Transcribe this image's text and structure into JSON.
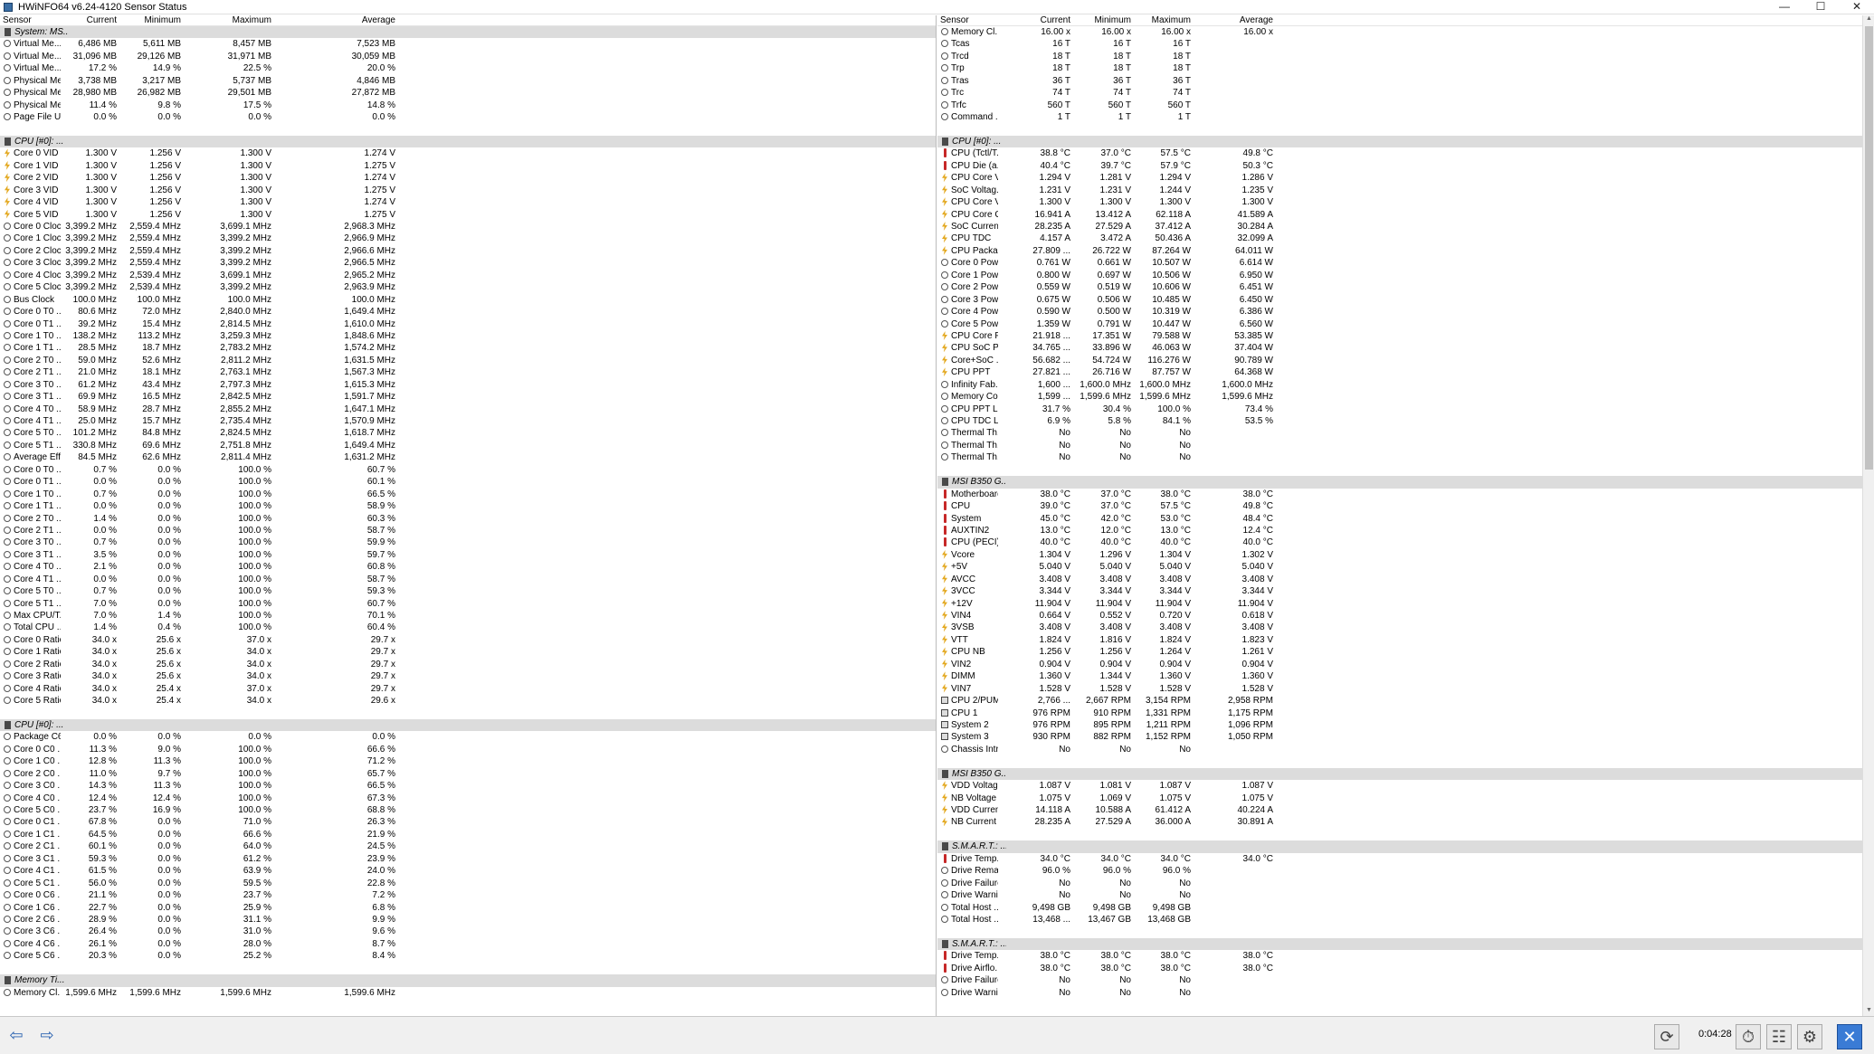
{
  "window": {
    "title": "HWiNFO64 v6.24-4120 Sensor Status",
    "minimize": "—",
    "maximize": "☐",
    "close": "✕"
  },
  "columns": [
    "Sensor",
    "Current",
    "Minimum",
    "Maximum",
    "Average"
  ],
  "left": [
    [
      "s",
      "System: MS..."
    ],
    [
      "c",
      "Virtual Me...",
      "6,486 MB",
      "5,611 MB",
      "8,457 MB",
      "7,523 MB"
    ],
    [
      "c",
      "Virtual Me...",
      "31,096 MB",
      "29,126 MB",
      "31,971 MB",
      "30,059 MB"
    ],
    [
      "c",
      "Virtual Me...",
      "17.2 %",
      "14.9 %",
      "22.5 %",
      "20.0 %"
    ],
    [
      "c",
      "Physical Me...",
      "3,738 MB",
      "3,217 MB",
      "5,737 MB",
      "4,846 MB"
    ],
    [
      "c",
      "Physical Me...",
      "28,980 MB",
      "26,982 MB",
      "29,501 MB",
      "27,872 MB"
    ],
    [
      "c",
      "Physical Me...",
      "11.4 %",
      "9.8 %",
      "17.5 %",
      "14.8 %"
    ],
    [
      "c",
      "Page File U...",
      "0.0 %",
      "0.0 %",
      "0.0 %",
      "0.0 %"
    ],
    [
      "x"
    ],
    [
      "s",
      "CPU [#0]: ..."
    ],
    [
      "v",
      "Core 0 VID",
      "1.300 V",
      "1.256 V",
      "1.300 V",
      "1.274 V"
    ],
    [
      "v",
      "Core 1 VID",
      "1.300 V",
      "1.256 V",
      "1.300 V",
      "1.275 V"
    ],
    [
      "v",
      "Core 2 VID",
      "1.300 V",
      "1.256 V",
      "1.300 V",
      "1.274 V"
    ],
    [
      "v",
      "Core 3 VID",
      "1.300 V",
      "1.256 V",
      "1.300 V",
      "1.275 V"
    ],
    [
      "v",
      "Core 4 VID",
      "1.300 V",
      "1.256 V",
      "1.300 V",
      "1.274 V"
    ],
    [
      "v",
      "Core 5 VID",
      "1.300 V",
      "1.256 V",
      "1.300 V",
      "1.275 V"
    ],
    [
      "c",
      "Core 0 Clock",
      "3,399.2 MHz",
      "2,559.4 MHz",
      "3,699.1 MHz",
      "2,968.3 MHz"
    ],
    [
      "c",
      "Core 1 Clock",
      "3,399.2 MHz",
      "2,559.4 MHz",
      "3,399.2 MHz",
      "2,966.9 MHz"
    ],
    [
      "c",
      "Core 2 Clock",
      "3,399.2 MHz",
      "2,559.4 MHz",
      "3,399.2 MHz",
      "2,966.6 MHz"
    ],
    [
      "c",
      "Core 3 Clock",
      "3,399.2 MHz",
      "2,559.4 MHz",
      "3,399.2 MHz",
      "2,966.5 MHz"
    ],
    [
      "c",
      "Core 4 Clock",
      "3,399.2 MHz",
      "2,539.4 MHz",
      "3,699.1 MHz",
      "2,965.2 MHz"
    ],
    [
      "c",
      "Core 5 Clock",
      "3,399.2 MHz",
      "2,539.4 MHz",
      "3,399.2 MHz",
      "2,963.9 MHz"
    ],
    [
      "c",
      "Bus Clock",
      "100.0 MHz",
      "100.0 MHz",
      "100.0 MHz",
      "100.0 MHz"
    ],
    [
      "c",
      "Core 0 T0 ...",
      "80.6 MHz",
      "72.0 MHz",
      "2,840.0 MHz",
      "1,649.4 MHz"
    ],
    [
      "c",
      "Core 0 T1 ...",
      "39.2 MHz",
      "15.4 MHz",
      "2,814.5 MHz",
      "1,610.0 MHz"
    ],
    [
      "c",
      "Core 1 T0 ...",
      "138.2 MHz",
      "113.2 MHz",
      "3,259.3 MHz",
      "1,848.6 MHz"
    ],
    [
      "c",
      "Core 1 T1 ...",
      "28.5 MHz",
      "18.7 MHz",
      "2,783.2 MHz",
      "1,574.2 MHz"
    ],
    [
      "c",
      "Core 2 T0 ...",
      "59.0 MHz",
      "52.6 MHz",
      "2,811.2 MHz",
      "1,631.5 MHz"
    ],
    [
      "c",
      "Core 2 T1 ...",
      "21.0 MHz",
      "18.1 MHz",
      "2,763.1 MHz",
      "1,567.3 MHz"
    ],
    [
      "c",
      "Core 3 T0 ...",
      "61.2 MHz",
      "43.4 MHz",
      "2,797.3 MHz",
      "1,615.3 MHz"
    ],
    [
      "c",
      "Core 3 T1 ...",
      "69.9 MHz",
      "16.5 MHz",
      "2,842.5 MHz",
      "1,591.7 MHz"
    ],
    [
      "c",
      "Core 4 T0 ...",
      "58.9 MHz",
      "28.7 MHz",
      "2,855.2 MHz",
      "1,647.1 MHz"
    ],
    [
      "c",
      "Core 4 T1 ...",
      "25.0 MHz",
      "15.7 MHz",
      "2,735.4 MHz",
      "1,570.9 MHz"
    ],
    [
      "c",
      "Core 5 T0 ...",
      "101.2 MHz",
      "84.8 MHz",
      "2,824.5 MHz",
      "1,618.7 MHz"
    ],
    [
      "c",
      "Core 5 T1 ...",
      "330.8 MHz",
      "69.6 MHz",
      "2,751.8 MHz",
      "1,649.4 MHz"
    ],
    [
      "c",
      "Average Eff...",
      "84.5 MHz",
      "62.6 MHz",
      "2,811.4 MHz",
      "1,631.2 MHz"
    ],
    [
      "c",
      "Core 0 T0 ...",
      "0.7 %",
      "0.0 %",
      "100.0 %",
      "60.7 %"
    ],
    [
      "c",
      "Core 0 T1 ...",
      "0.0 %",
      "0.0 %",
      "100.0 %",
      "60.1 %"
    ],
    [
      "c",
      "Core 1 T0 ...",
      "0.7 %",
      "0.0 %",
      "100.0 %",
      "66.5 %"
    ],
    [
      "c",
      "Core 1 T1 ...",
      "0.0 %",
      "0.0 %",
      "100.0 %",
      "58.9 %"
    ],
    [
      "c",
      "Core 2 T0 ...",
      "1.4 %",
      "0.0 %",
      "100.0 %",
      "60.3 %"
    ],
    [
      "c",
      "Core 2 T1 ...",
      "0.0 %",
      "0.0 %",
      "100.0 %",
      "58.7 %"
    ],
    [
      "c",
      "Core 3 T0 ...",
      "0.7 %",
      "0.0 %",
      "100.0 %",
      "59.9 %"
    ],
    [
      "c",
      "Core 3 T1 ...",
      "3.5 %",
      "0.0 %",
      "100.0 %",
      "59.7 %"
    ],
    [
      "c",
      "Core 4 T0 ...",
      "2.1 %",
      "0.0 %",
      "100.0 %",
      "60.8 %"
    ],
    [
      "c",
      "Core 4 T1 ...",
      "0.0 %",
      "0.0 %",
      "100.0 %",
      "58.7 %"
    ],
    [
      "c",
      "Core 5 T0 ...",
      "0.7 %",
      "0.0 %",
      "100.0 %",
      "59.3 %"
    ],
    [
      "c",
      "Core 5 T1 ...",
      "7.0 %",
      "0.0 %",
      "100.0 %",
      "60.7 %"
    ],
    [
      "c",
      "Max CPU/T...",
      "7.0 %",
      "1.4 %",
      "100.0 %",
      "70.1 %"
    ],
    [
      "c",
      "Total CPU ...",
      "1.4 %",
      "0.4 %",
      "100.0 %",
      "60.4 %"
    ],
    [
      "c",
      "Core 0 Ratio",
      "34.0 x",
      "25.6 x",
      "37.0 x",
      "29.7 x"
    ],
    [
      "c",
      "Core 1 Ratio",
      "34.0 x",
      "25.6 x",
      "34.0 x",
      "29.7 x"
    ],
    [
      "c",
      "Core 2 Ratio",
      "34.0 x",
      "25.6 x",
      "34.0 x",
      "29.7 x"
    ],
    [
      "c",
      "Core 3 Ratio",
      "34.0 x",
      "25.6 x",
      "34.0 x",
      "29.7 x"
    ],
    [
      "c",
      "Core 4 Ratio",
      "34.0 x",
      "25.4 x",
      "37.0 x",
      "29.7 x"
    ],
    [
      "c",
      "Core 5 Ratio",
      "34.0 x",
      "25.4 x",
      "34.0 x",
      "29.6 x"
    ],
    [
      "x"
    ],
    [
      "s",
      "CPU [#0]: ..."
    ],
    [
      "c",
      "Package C6...",
      "0.0 %",
      "0.0 %",
      "0.0 %",
      "0.0 %"
    ],
    [
      "c",
      "Core 0 C0 ...",
      "11.3 %",
      "9.0 %",
      "100.0 %",
      "66.6 %"
    ],
    [
      "c",
      "Core 1 C0 ...",
      "12.8 %",
      "11.3 %",
      "100.0 %",
      "71.2 %"
    ],
    [
      "c",
      "Core 2 C0 ...",
      "11.0 %",
      "9.7 %",
      "100.0 %",
      "65.7 %"
    ],
    [
      "c",
      "Core 3 C0 ...",
      "14.3 %",
      "11.3 %",
      "100.0 %",
      "66.5 %"
    ],
    [
      "c",
      "Core 4 C0 ...",
      "12.4 %",
      "12.4 %",
      "100.0 %",
      "67.3 %"
    ],
    [
      "c",
      "Core 5 C0 ...",
      "23.7 %",
      "16.9 %",
      "100.0 %",
      "68.8 %"
    ],
    [
      "c",
      "Core 0 C1 ...",
      "67.8 %",
      "0.0 %",
      "71.0 %",
      "26.3 %"
    ],
    [
      "c",
      "Core 1 C1 ...",
      "64.5 %",
      "0.0 %",
      "66.6 %",
      "21.9 %"
    ],
    [
      "c",
      "Core 2 C1 ...",
      "60.1 %",
      "0.0 %",
      "64.0 %",
      "24.5 %"
    ],
    [
      "c",
      "Core 3 C1 ...",
      "59.3 %",
      "0.0 %",
      "61.2 %",
      "23.9 %"
    ],
    [
      "c",
      "Core 4 C1 ...",
      "61.5 %",
      "0.0 %",
      "63.9 %",
      "24.0 %"
    ],
    [
      "c",
      "Core 5 C1 ...",
      "56.0 %",
      "0.0 %",
      "59.5 %",
      "22.8 %"
    ],
    [
      "c",
      "Core 0 C6 ...",
      "21.1 %",
      "0.0 %",
      "23.7 %",
      "7.2 %"
    ],
    [
      "c",
      "Core 1 C6 ...",
      "22.7 %",
      "0.0 %",
      "25.9 %",
      "6.8 %"
    ],
    [
      "c",
      "Core 2 C6 ...",
      "28.9 %",
      "0.0 %",
      "31.1 %",
      "9.9 %"
    ],
    [
      "c",
      "Core 3 C6 ...",
      "26.4 %",
      "0.0 %",
      "31.0 %",
      "9.6 %"
    ],
    [
      "c",
      "Core 4 C6 ...",
      "26.1 %",
      "0.0 %",
      "28.0 %",
      "8.7 %"
    ],
    [
      "c",
      "Core 5 C6 ...",
      "20.3 %",
      "0.0 %",
      "25.2 %",
      "8.4 %"
    ],
    [
      "x"
    ],
    [
      "s",
      "Memory Ti..."
    ],
    [
      "c",
      "Memory Cl...",
      "1,599.6 MHz",
      "1,599.6 MHz",
      "1,599.6 MHz",
      "1,599.6 MHz"
    ]
  ],
  "right": [
    [
      "c",
      "Memory Cl...",
      "16.00 x",
      "16.00 x",
      "16.00 x",
      "16.00 x"
    ],
    [
      "c",
      "Tcas",
      "16 T",
      "16 T",
      "16 T",
      ""
    ],
    [
      "c",
      "Trcd",
      "18 T",
      "18 T",
      "18 T",
      ""
    ],
    [
      "c",
      "Trp",
      "18 T",
      "18 T",
      "18 T",
      ""
    ],
    [
      "c",
      "Tras",
      "36 T",
      "36 T",
      "36 T",
      ""
    ],
    [
      "c",
      "Trc",
      "74 T",
      "74 T",
      "74 T",
      ""
    ],
    [
      "c",
      "Trfc",
      "560 T",
      "560 T",
      "560 T",
      ""
    ],
    [
      "c",
      "Command ...",
      "1 T",
      "1 T",
      "1 T",
      ""
    ],
    [
      "x"
    ],
    [
      "s",
      "CPU [#0]: ..."
    ],
    [
      "t",
      "CPU (Tctl/T...",
      "38.8 °C",
      "37.0 °C",
      "57.5 °C",
      "49.8 °C"
    ],
    [
      "t",
      "CPU Die (a...",
      "40.4 °C",
      "39.7 °C",
      "57.9 °C",
      "50.3 °C"
    ],
    [
      "v",
      "CPU Core V...",
      "1.294 V",
      "1.281 V",
      "1.294 V",
      "1.286 V"
    ],
    [
      "v",
      "SoC Voltag...",
      "1.231 V",
      "1.231 V",
      "1.244 V",
      "1.235 V"
    ],
    [
      "v",
      "CPU Core V...",
      "1.300 V",
      "1.300 V",
      "1.300 V",
      "1.300 V"
    ],
    [
      "v",
      "CPU Core C...",
      "16.941 A",
      "13.412 A",
      "62.118 A",
      "41.589 A"
    ],
    [
      "v",
      "SoC Curren...",
      "28.235 A",
      "27.529 A",
      "37.412 A",
      "30.284 A"
    ],
    [
      "v",
      "CPU TDC",
      "4.157 A",
      "3.472 A",
      "50.436 A",
      "32.099 A"
    ],
    [
      "v",
      "CPU Packag...",
      "27.809 ...",
      "26.722 W",
      "87.264 W",
      "64.011 W"
    ],
    [
      "c",
      "Core 0 Pow...",
      "0.761 W",
      "0.661 W",
      "10.507 W",
      "6.614 W"
    ],
    [
      "c",
      "Core 1 Pow...",
      "0.800 W",
      "0.697 W",
      "10.506 W",
      "6.950 W"
    ],
    [
      "c",
      "Core 2 Pow...",
      "0.559 W",
      "0.519 W",
      "10.606 W",
      "6.451 W"
    ],
    [
      "c",
      "Core 3 Pow...",
      "0.675 W",
      "0.506 W",
      "10.485 W",
      "6.450 W"
    ],
    [
      "c",
      "Core 4 Pow...",
      "0.590 W",
      "0.500 W",
      "10.319 W",
      "6.386 W"
    ],
    [
      "c",
      "Core 5 Pow...",
      "1.359 W",
      "0.791 W",
      "10.447 W",
      "6.560 W"
    ],
    [
      "v",
      "CPU Core P...",
      "21.918 ...",
      "17.351 W",
      "79.588 W",
      "53.385 W"
    ],
    [
      "v",
      "CPU SoC P...",
      "34.765 ...",
      "33.896 W",
      "46.063 W",
      "37.404 W"
    ],
    [
      "v",
      "Core+SoC ...",
      "56.682 ...",
      "54.724 W",
      "116.276 W",
      "90.789 W"
    ],
    [
      "v",
      "CPU PPT",
      "27.821 ...",
      "26.716 W",
      "87.757 W",
      "64.368 W"
    ],
    [
      "c",
      "Infinity Fab...",
      "1,600 ...",
      "1,600.0 MHz",
      "1,600.0 MHz",
      "1,600.0 MHz"
    ],
    [
      "c",
      "Memory Co...",
      "1,599 ...",
      "1,599.6 MHz",
      "1,599.6 MHz",
      "1,599.6 MHz"
    ],
    [
      "c",
      "CPU PPT Li...",
      "31.7 %",
      "30.4 %",
      "100.0 %",
      "73.4 %"
    ],
    [
      "c",
      "CPU TDC Li...",
      "6.9 %",
      "5.8 %",
      "84.1 %",
      "53.5 %"
    ],
    [
      "c",
      "Thermal Th...",
      "No",
      "No",
      "No",
      ""
    ],
    [
      "c",
      "Thermal Th...",
      "No",
      "No",
      "No",
      ""
    ],
    [
      "c",
      "Thermal Th...",
      "No",
      "No",
      "No",
      ""
    ],
    [
      "x"
    ],
    [
      "s",
      "MSI B350 G..."
    ],
    [
      "t",
      "Motherboard",
      "38.0 °C",
      "37.0 °C",
      "38.0 °C",
      "38.0 °C"
    ],
    [
      "t",
      "CPU",
      "39.0 °C",
      "37.0 °C",
      "57.5 °C",
      "49.8 °C"
    ],
    [
      "t",
      "System",
      "45.0 °C",
      "42.0 °C",
      "53.0 °C",
      "48.4 °C"
    ],
    [
      "t",
      "AUXTIN2",
      "13.0 °C",
      "12.0 °C",
      "13.0 °C",
      "12.4 °C"
    ],
    [
      "t",
      "CPU (PECI)",
      "40.0 °C",
      "40.0 °C",
      "40.0 °C",
      "40.0 °C"
    ],
    [
      "v",
      "Vcore",
      "1.304 V",
      "1.296 V",
      "1.304 V",
      "1.302 V"
    ],
    [
      "v",
      "+5V",
      "5.040 V",
      "5.040 V",
      "5.040 V",
      "5.040 V"
    ],
    [
      "v",
      "AVCC",
      "3.408 V",
      "3.408 V",
      "3.408 V",
      "3.408 V"
    ],
    [
      "v",
      "3VCC",
      "3.344 V",
      "3.344 V",
      "3.344 V",
      "3.344 V"
    ],
    [
      "v",
      "+12V",
      "11.904 V",
      "11.904 V",
      "11.904 V",
      "11.904 V"
    ],
    [
      "v",
      "VIN4",
      "0.664 V",
      "0.552 V",
      "0.720 V",
      "0.618 V"
    ],
    [
      "v",
      "3VSB",
      "3.408 V",
      "3.408 V",
      "3.408 V",
      "3.408 V"
    ],
    [
      "v",
      "VTT",
      "1.824 V",
      "1.816 V",
      "1.824 V",
      "1.823 V"
    ],
    [
      "v",
      "CPU NB",
      "1.256 V",
      "1.256 V",
      "1.264 V",
      "1.261 V"
    ],
    [
      "v",
      "VIN2",
      "0.904 V",
      "0.904 V",
      "0.904 V",
      "0.904 V"
    ],
    [
      "v",
      "DIMM",
      "1.360 V",
      "1.344 V",
      "1.360 V",
      "1.360 V"
    ],
    [
      "v",
      "VIN7",
      "1.528 V",
      "1.528 V",
      "1.528 V",
      "1.528 V"
    ],
    [
      "f",
      "CPU 2/PUM...",
      "2,766 ...",
      "2,667 RPM",
      "3,154 RPM",
      "2,958 RPM"
    ],
    [
      "f",
      "CPU 1",
      "976 RPM",
      "910 RPM",
      "1,331 RPM",
      "1,175 RPM"
    ],
    [
      "f",
      "System 2",
      "976 RPM",
      "895 RPM",
      "1,211 RPM",
      "1,096 RPM"
    ],
    [
      "f",
      "System 3",
      "930 RPM",
      "882 RPM",
      "1,152 RPM",
      "1,050 RPM"
    ],
    [
      "c",
      "Chassis Intr...",
      "No",
      "No",
      "No",
      ""
    ],
    [
      "x"
    ],
    [
      "s",
      "MSI B350 G..."
    ],
    [
      "v",
      "VDD Voltage",
      "1.087 V",
      "1.081 V",
      "1.087 V",
      "1.087 V"
    ],
    [
      "v",
      "NB Voltage",
      "1.075 V",
      "1.069 V",
      "1.075 V",
      "1.075 V"
    ],
    [
      "v",
      "VDD Current",
      "14.118 A",
      "10.588 A",
      "61.412 A",
      "40.224 A"
    ],
    [
      "v",
      "NB Current",
      "28.235 A",
      "27.529 A",
      "36.000 A",
      "30.891 A"
    ],
    [
      "x"
    ],
    [
      "s",
      "S.M.A.R.T.: ..."
    ],
    [
      "t",
      "Drive Temp...",
      "34.0 °C",
      "34.0 °C",
      "34.0 °C",
      "34.0 °C"
    ],
    [
      "c",
      "Drive Rema...",
      "96.0 %",
      "96.0 %",
      "96.0 %",
      ""
    ],
    [
      "c",
      "Drive Failure",
      "No",
      "No",
      "No",
      ""
    ],
    [
      "c",
      "Drive Warni...",
      "No",
      "No",
      "No",
      ""
    ],
    [
      "c",
      "Total Host ...",
      "9,498 GB",
      "9,498 GB",
      "9,498 GB",
      ""
    ],
    [
      "c",
      "Total Host ...",
      "13,468 ...",
      "13,467 GB",
      "13,468 GB",
      ""
    ],
    [
      "x"
    ],
    [
      "s",
      "S.M.A.R.T.: ..."
    ],
    [
      "t",
      "Drive Temp...",
      "38.0 °C",
      "38.0 °C",
      "38.0 °C",
      "38.0 °C"
    ],
    [
      "t",
      "Drive Airflo...",
      "38.0 °C",
      "38.0 °C",
      "38.0 °C",
      "38.0 °C"
    ],
    [
      "c",
      "Drive Failure",
      "No",
      "No",
      "No",
      ""
    ],
    [
      "c",
      "Drive Warni...",
      "No",
      "No",
      "No",
      ""
    ]
  ],
  "bottom": {
    "back": "⇦",
    "forward": "⇨",
    "elapsed": "0:04:28",
    "reset_icon": "⟳",
    "clock_icon": "⏱",
    "log_icon": "☷",
    "settings_icon": "⚙",
    "close_icon": "✕"
  }
}
